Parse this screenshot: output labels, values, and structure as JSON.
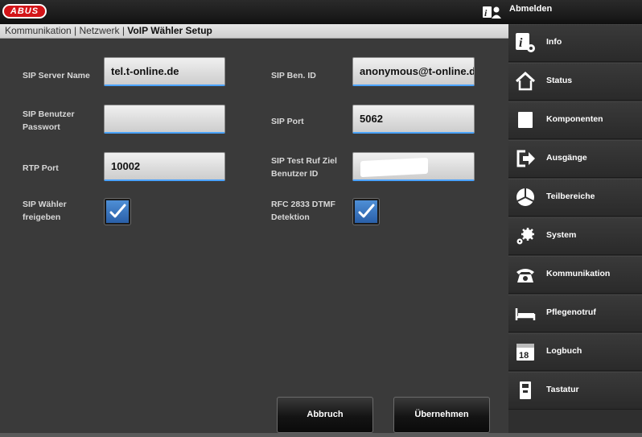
{
  "header": {
    "logo_text": "ABUS",
    "logout_label": "Abmelden"
  },
  "breadcrumb": {
    "path": "Kommunikation | Netzwerk | ",
    "current": "VoIP Wähler Setup"
  },
  "form": {
    "sip_server_name": {
      "label": "SIP Server Name",
      "value": "tel.t-online.de"
    },
    "sip_ben_id": {
      "label": "SIP Ben. ID",
      "value": "anonymous@t-online.de"
    },
    "sip_password": {
      "label": "SIP Benutzer Passwort",
      "value": ""
    },
    "sip_port": {
      "label": "SIP Port",
      "value": "5062"
    },
    "rtp_port": {
      "label": "RTP Port",
      "value": "10002"
    },
    "sip_test_call": {
      "label": "SIP Test Ruf Ziel Benutzer ID",
      "value": ""
    },
    "sip_dialer_enable": {
      "label": "SIP Wähler freigeben",
      "checked": true
    },
    "rfc2833": {
      "label": "RFC 2833 DTMF Detektion",
      "checked": true
    }
  },
  "buttons": {
    "cancel": "Abbruch",
    "apply": "Übernehmen"
  },
  "sidebar": {
    "items": [
      {
        "label": "Info",
        "icon": "info-icon"
      },
      {
        "label": "Status",
        "icon": "home-icon"
      },
      {
        "label": "Komponenten",
        "icon": "square-icon"
      },
      {
        "label": "Ausgänge",
        "icon": "exit-icon"
      },
      {
        "label": "Teilbereiche",
        "icon": "pie-icon"
      },
      {
        "label": "System",
        "icon": "gears-icon"
      },
      {
        "label": "Kommunikation",
        "icon": "phone-icon"
      },
      {
        "label": "Pflegenotruf",
        "icon": "bed-icon"
      },
      {
        "label": "Logbuch",
        "icon": "calendar-icon"
      },
      {
        "label": "Tastatur",
        "icon": "keypad-icon"
      }
    ]
  },
  "colors": {
    "accent_blue": "#4aa3ff",
    "logo_red": "#d31418",
    "background": "#3a3a3a"
  }
}
